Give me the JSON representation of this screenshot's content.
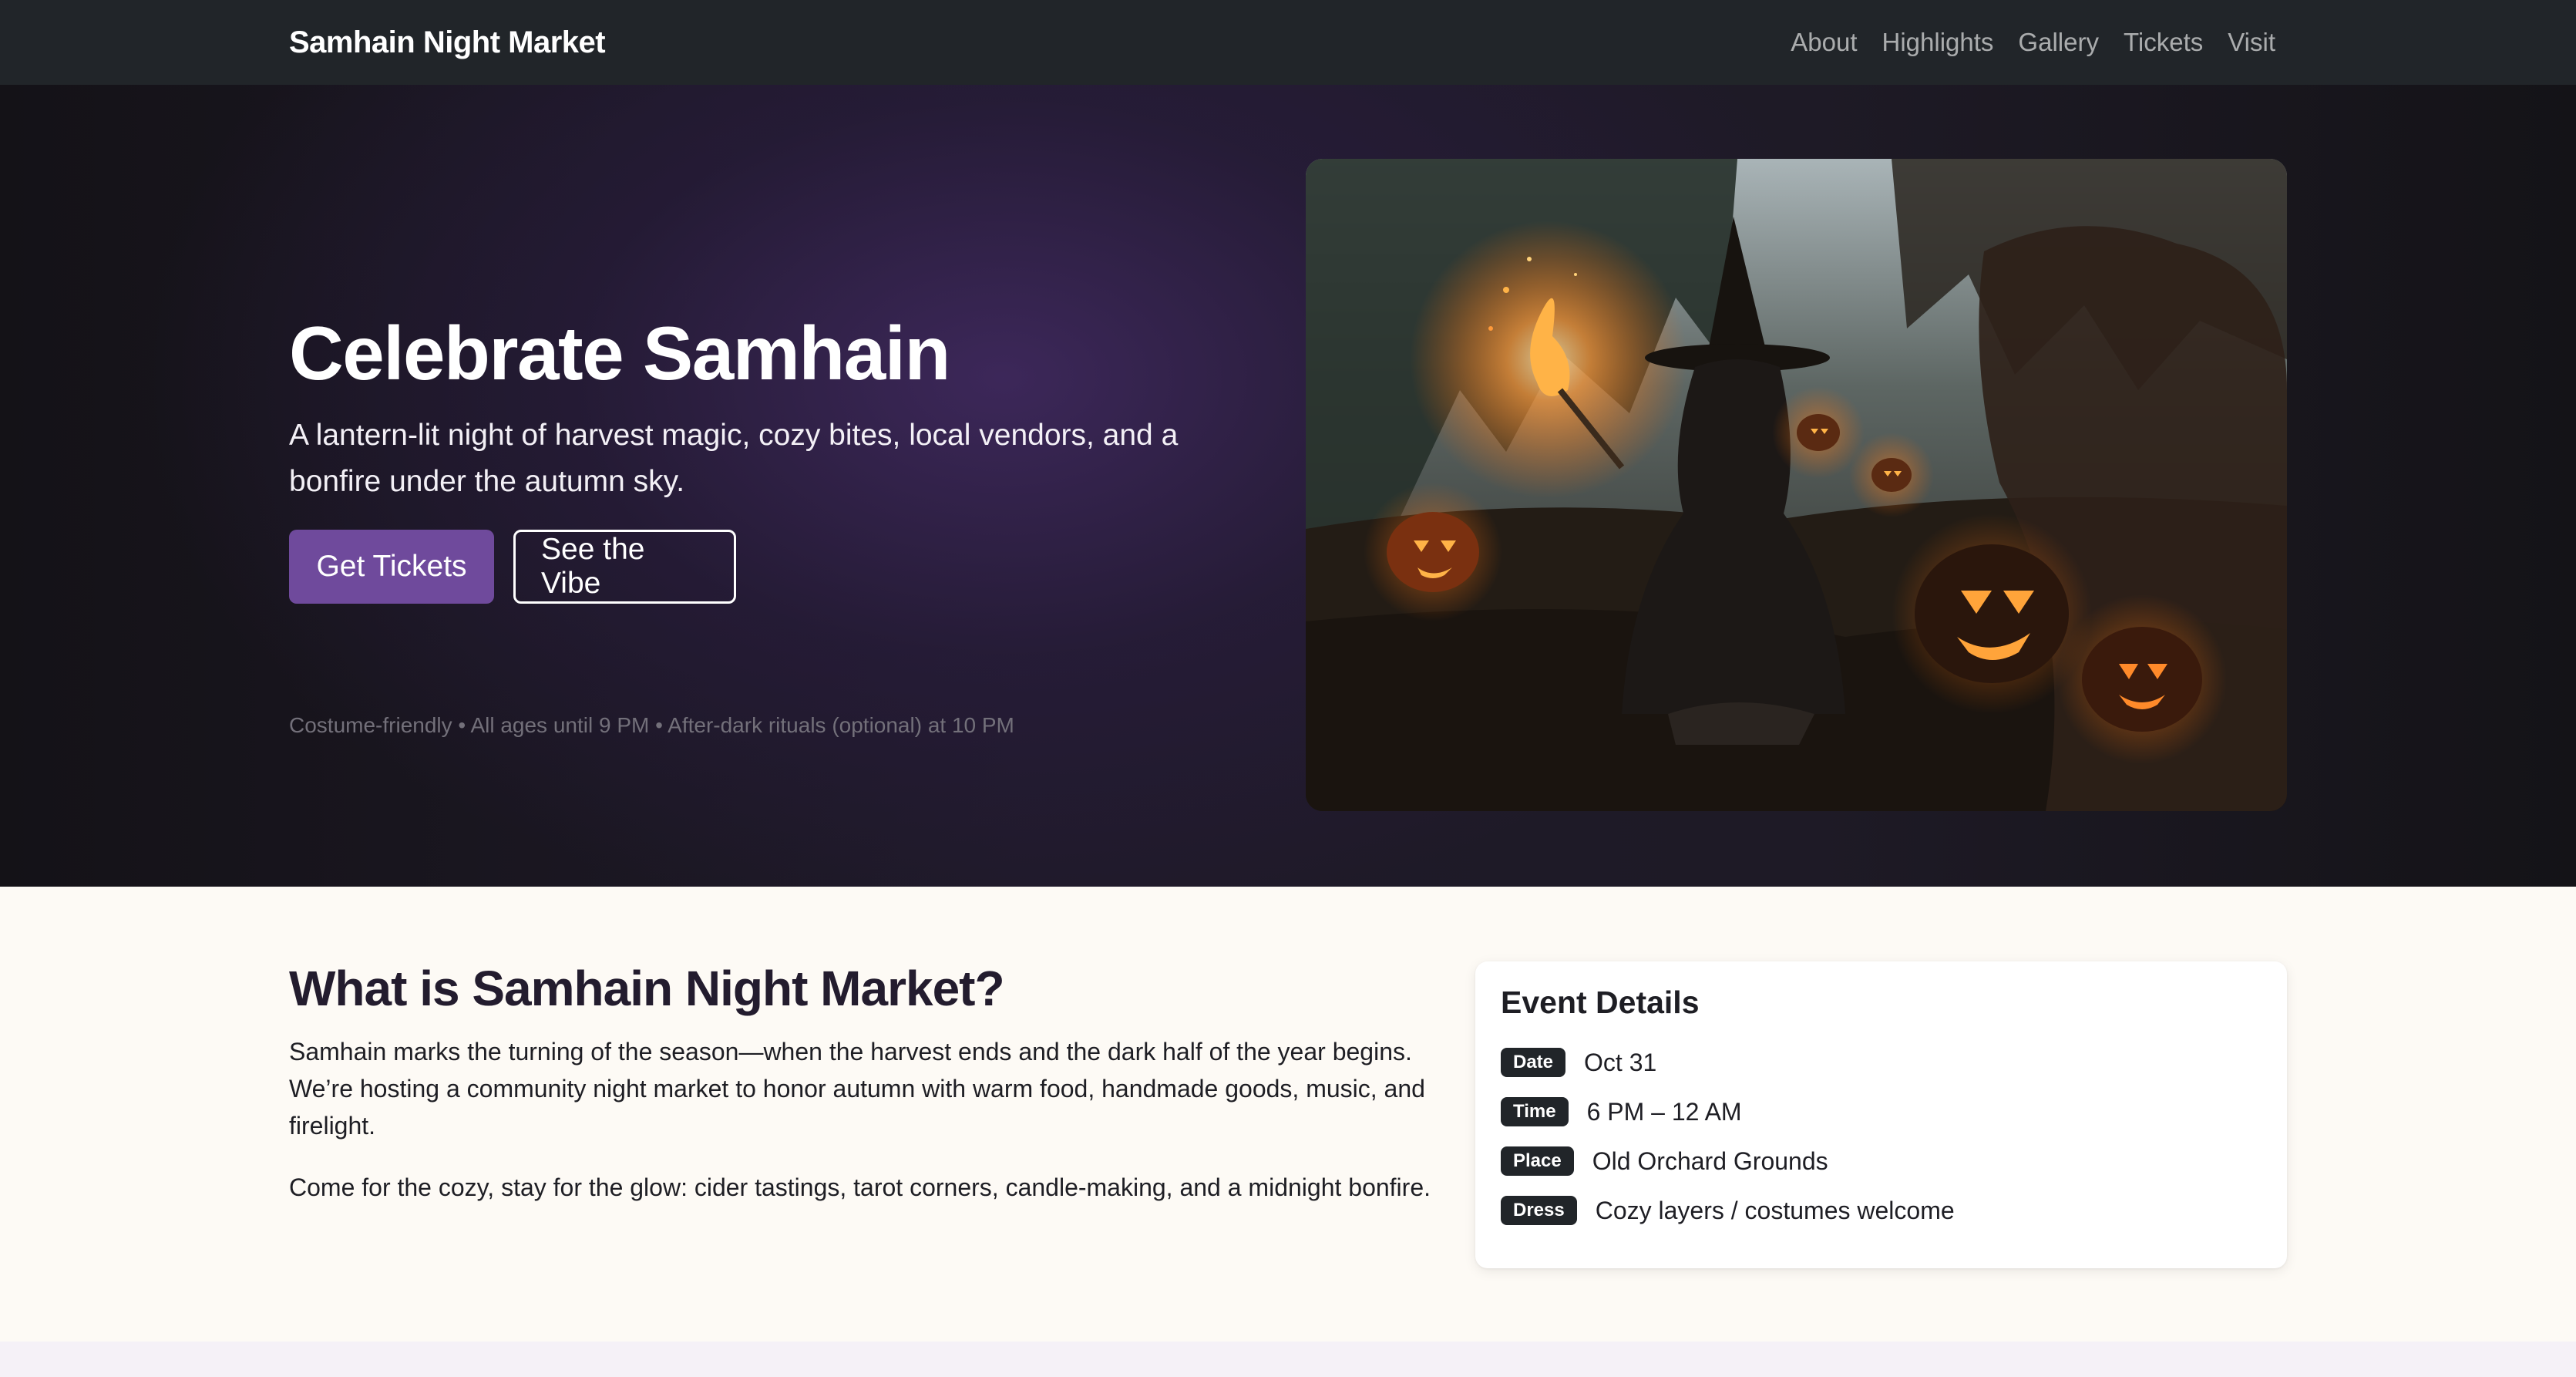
{
  "navbar": {
    "brand": "Samhain Night Market",
    "links": [
      "About",
      "Highlights",
      "Gallery",
      "Tickets",
      "Visit"
    ]
  },
  "hero": {
    "title": "Celebrate Samhain",
    "lead": "A lantern-lit night of harvest magic, cozy bites, local vendors, and a bonfire under the autumn sky.",
    "primary_button": "Get Tickets",
    "secondary_button": "See the Vibe",
    "note": "Costume-friendly • All ages until 9 PM • After-dark rituals (optional) at 10 PM"
  },
  "about": {
    "title": "What is Samhain Night Market?",
    "paragraph1": "Samhain marks the turning of the season—when the harvest ends and the dark half of the year begins. We’re hosting a community night market to honor autumn with warm food, handmade goods, music, and firelight.",
    "paragraph2": "Come for the cozy, stay for the glow: cider tastings, tarot corners, candle-making, and a midnight bonfire."
  },
  "event_details": {
    "title": "Event Details",
    "rows": [
      {
        "label": "Date",
        "value": "Oct 31"
      },
      {
        "label": "Time",
        "value": "6 PM – 12 AM"
      },
      {
        "label": "Place",
        "value": "Old Orchard Grounds"
      },
      {
        "label": "Dress",
        "value": "Cozy layers / costumes welcome"
      }
    ]
  },
  "colors": {
    "accent": "#6f4a9c",
    "navbar": "#212529",
    "badge": "#212529"
  }
}
